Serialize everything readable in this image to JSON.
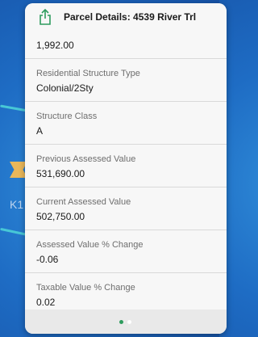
{
  "panel": {
    "title": "Parcel Details: 4539 River Trl",
    "first_value": "1,992.00",
    "fields": [
      {
        "label": "Residential Structure Type",
        "value": "Colonial/2Sty"
      },
      {
        "label": "Structure Class",
        "value": "A"
      },
      {
        "label": "Previous Assessed Value",
        "value": "531,690.00"
      },
      {
        "label": "Current Assessed Value",
        "value": "502,750.00"
      },
      {
        "label": "Assessed Value % Change",
        "value": "-0.06"
      },
      {
        "label": "Taxable Value % Change",
        "value": "0.02"
      }
    ],
    "pager": {
      "pages": 2,
      "current": 1
    }
  },
  "map": {
    "visible_label": "K1"
  },
  "colors": {
    "map_background": "#1e6cc4",
    "road": "#47c7d6",
    "marker": "#e9b75a",
    "active_dot": "#2e9c5e"
  },
  "icons": {
    "share": "share-icon"
  }
}
